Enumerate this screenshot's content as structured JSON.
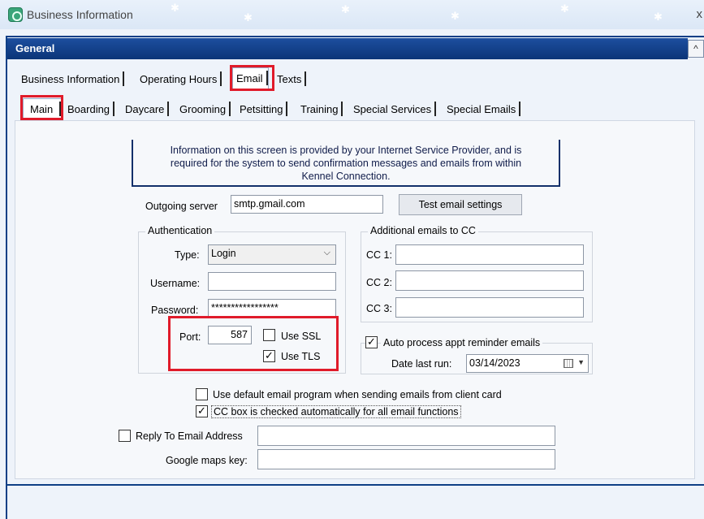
{
  "window": {
    "title": "Business Information",
    "close_glyph": "x"
  },
  "section": {
    "title": "General",
    "collapse_glyph": "^"
  },
  "top_tabs": [
    {
      "label": "Business Information"
    },
    {
      "label": "Operating Hours"
    },
    {
      "label": "Email",
      "active": true
    },
    {
      "label": "Texts"
    }
  ],
  "sub_tabs": [
    {
      "label": "Main",
      "active": true
    },
    {
      "label": "Boarding"
    },
    {
      "label": "Daycare"
    },
    {
      "label": "Grooming"
    },
    {
      "label": "Petsitting"
    },
    {
      "label": "Training"
    },
    {
      "label": "Special Services"
    },
    {
      "label": "Special Emails"
    }
  ],
  "info": {
    "line1": "Information on this screen is provided by your Internet Service Provider, and is",
    "line2": "required for the system to send confirmation messages and emails from within",
    "line3": "Kennel Connection."
  },
  "outgoing": {
    "label": "Outgoing server",
    "value": "smtp.gmail.com",
    "test_button": "Test email settings"
  },
  "auth": {
    "group_title": "Authentication",
    "type_label": "Type:",
    "type_value": "Login",
    "username_label": "Username:",
    "username_value": "",
    "password_label": "Password:",
    "password_value": "*****************",
    "port_label": "Port:",
    "port_value": "587",
    "ssl_label": "Use SSL",
    "ssl_checked": false,
    "tls_label": "Use TLS",
    "tls_checked": true
  },
  "cc": {
    "group_title": "Additional emails to CC",
    "cc1_label": "CC 1:",
    "cc2_label": "CC 2:",
    "cc3_label": "CC 3:",
    "cc1_value": "",
    "cc2_value": "",
    "cc3_value": ""
  },
  "reminder": {
    "label": "Auto process appt  reminder emails",
    "checked": true,
    "date_label": "Date last run:",
    "date_value": "03/14/2023"
  },
  "options": {
    "default_email_label": "Use default email program when sending emails from client card",
    "default_email_checked": false,
    "cc_box_label": "CC box is checked automatically for all email functions",
    "cc_box_checked": true
  },
  "reply_to": {
    "label": "Reply To Email Address",
    "checked": false,
    "value": ""
  },
  "google_maps": {
    "label": "Google maps key:",
    "value": ""
  },
  "colors": {
    "highlight": "#e01b2a",
    "header_blue": "#0b3578"
  }
}
